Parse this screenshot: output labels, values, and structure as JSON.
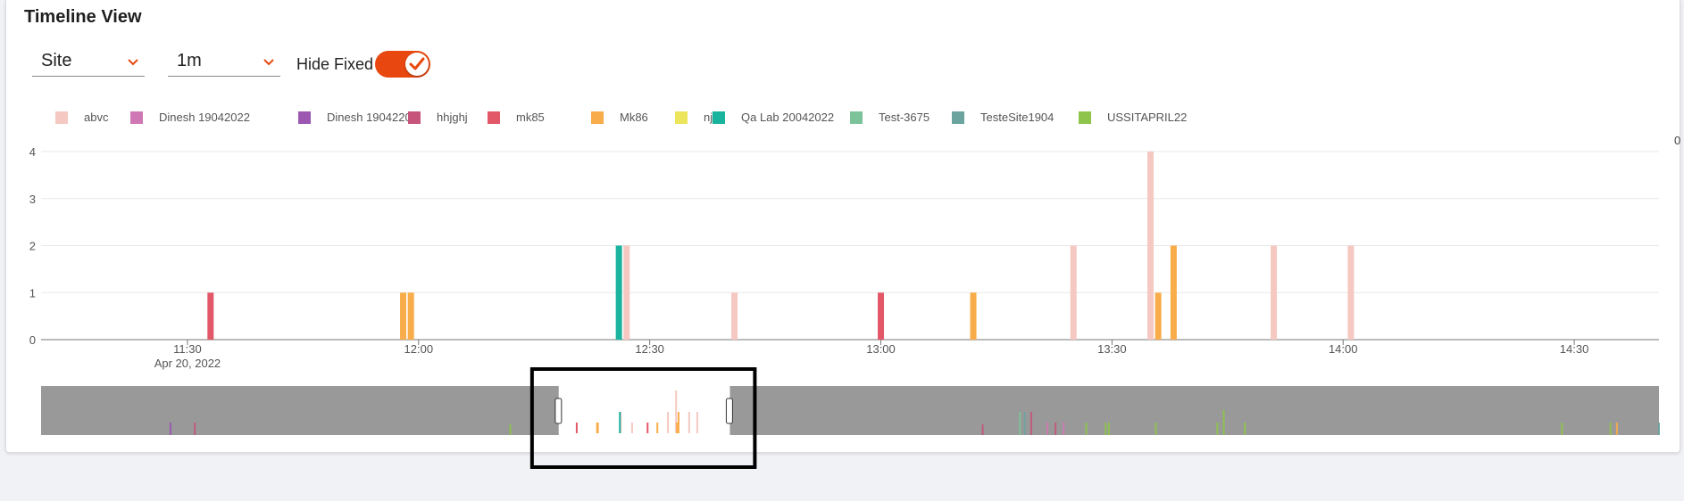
{
  "panel": {
    "title": "Timeline View"
  },
  "controls": {
    "group_select": {
      "value": "Site"
    },
    "interval_select": {
      "value": "1m"
    },
    "hide_fixed": {
      "label": "Hide Fixed",
      "on": true
    }
  },
  "colors": {
    "accent": "#e8480f",
    "navigator_bg": "#999999",
    "window_border": "#000000"
  },
  "edge_text": "0",
  "chart_data": {
    "type": "bar",
    "title": "",
    "xlabel": "",
    "ylabel": "",
    "ylim": [
      0,
      4
    ],
    "yticks": [
      "0",
      "1",
      "2",
      "3",
      "4"
    ],
    "xticks": [
      {
        "time": "11:30",
        "label": "11:30",
        "sublabel": "Apr 20, 2022"
      },
      {
        "time": "12:00",
        "label": "12:00"
      },
      {
        "time": "12:30",
        "label": "12:30"
      },
      {
        "time": "13:00",
        "label": "13:00"
      },
      {
        "time": "13:30",
        "label": "13:30"
      },
      {
        "time": "14:00",
        "label": "14:00"
      },
      {
        "time": "14:30",
        "label": "14:30"
      }
    ],
    "xrange": [
      "11:11",
      "14:41"
    ],
    "legend_position": "top-left",
    "series": [
      {
        "name": "abvc",
        "color": "#f5c9c1",
        "points": [
          [
            "12:27",
            2
          ],
          [
            "12:41",
            1
          ],
          [
            "13:25",
            2
          ],
          [
            "13:35",
            4
          ],
          [
            "13:51",
            2
          ],
          [
            "14:01",
            2
          ]
        ]
      },
      {
        "name": "Dinesh 19042022",
        "color": "#d077b6",
        "points": []
      },
      {
        "name": "Dinesh 19042203",
        "color": "#9c57b1",
        "points": []
      },
      {
        "name": "hhjghj",
        "color": "#c7547a",
        "points": []
      },
      {
        "name": "mk85",
        "color": "#e35868",
        "points": [
          [
            "11:33",
            1
          ],
          [
            "13:00",
            1
          ]
        ]
      },
      {
        "name": "Mk86",
        "color": "#f9ac4a",
        "points": [
          [
            "11:58",
            1
          ],
          [
            "11:59",
            1
          ],
          [
            "13:12",
            1
          ],
          [
            "13:36",
            1
          ],
          [
            "13:38",
            2
          ]
        ]
      },
      {
        "name": "njk",
        "color": "#ece45a",
        "points": []
      },
      {
        "name": "Qa Lab 20042022",
        "color": "#1ab39e",
        "points": [
          [
            "12:26",
            2
          ]
        ]
      },
      {
        "name": "Test-3675",
        "color": "#7cc39a",
        "points": []
      },
      {
        "name": "TesteSite1904",
        "color": "#6ba49f",
        "points": []
      },
      {
        "name": "USSITAPRIL22",
        "color": "#8ec44b",
        "points": []
      }
    ]
  }
}
